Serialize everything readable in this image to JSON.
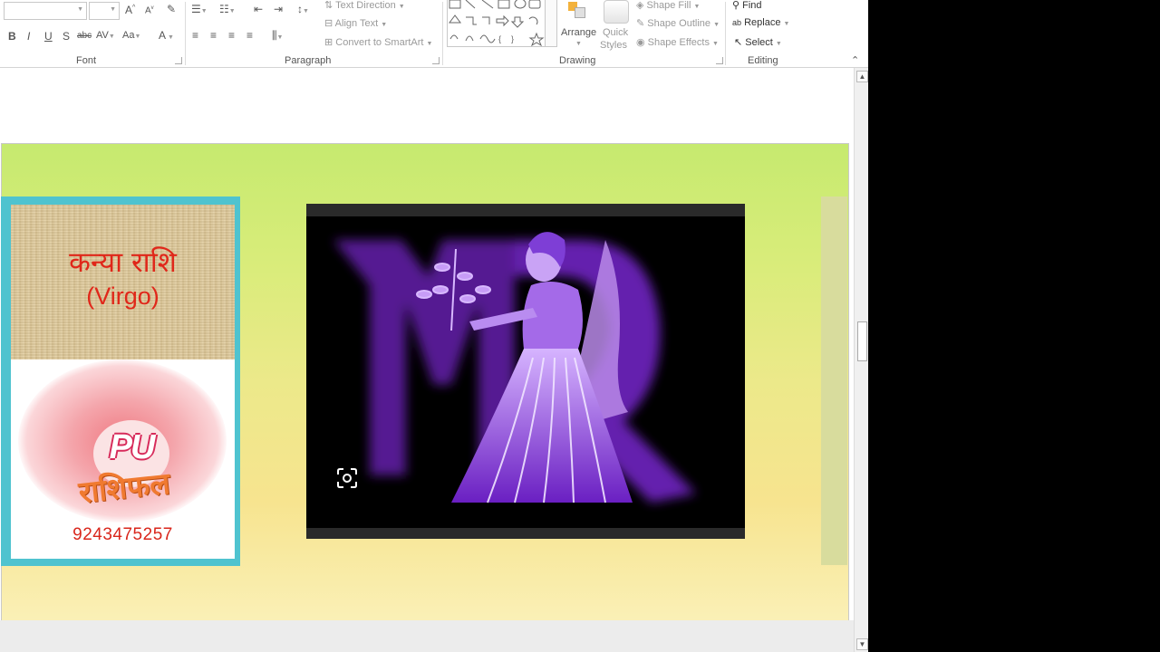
{
  "ribbon": {
    "groups": {
      "font": "Font",
      "paragraph": "Paragraph",
      "drawing": "Drawing",
      "editing": "Editing"
    },
    "font_buttons": {
      "bold": "B",
      "italic": "I",
      "underline": "U",
      "shadow": "S",
      "strike": "abc",
      "spacing": "AV",
      "case": "Aa",
      "color": "A",
      "grow": "A",
      "shrink": "A"
    },
    "paragraph": {
      "text_direction": "Text Direction",
      "align_text": "Align Text",
      "smartart": "Convert to SmartArt"
    },
    "drawing": {
      "arrange": "Arrange",
      "quick_styles_1": "Quick",
      "quick_styles_2": "Styles",
      "shape_fill": "Shape Fill",
      "shape_outline": "Shape Outline",
      "shape_effects": "Shape Effects"
    },
    "editing": {
      "find": "Find",
      "replace": "Replace",
      "select": "Select"
    }
  },
  "slide": {
    "card": {
      "title": "कन्या राशि",
      "subtitle": "(Virgo)",
      "logo_pu": "PU",
      "logo_text": "राशिफल",
      "phone": "9243475257"
    },
    "image_alt": "Virgo zodiac maiden illustration"
  },
  "colors": {
    "slide_green": "#c6ea6f",
    "slide_yellow": "#faf0b6",
    "card_border": "#4fc3cf",
    "title_red": "#e0271a",
    "virgo_purple": "#7a2bd0"
  }
}
